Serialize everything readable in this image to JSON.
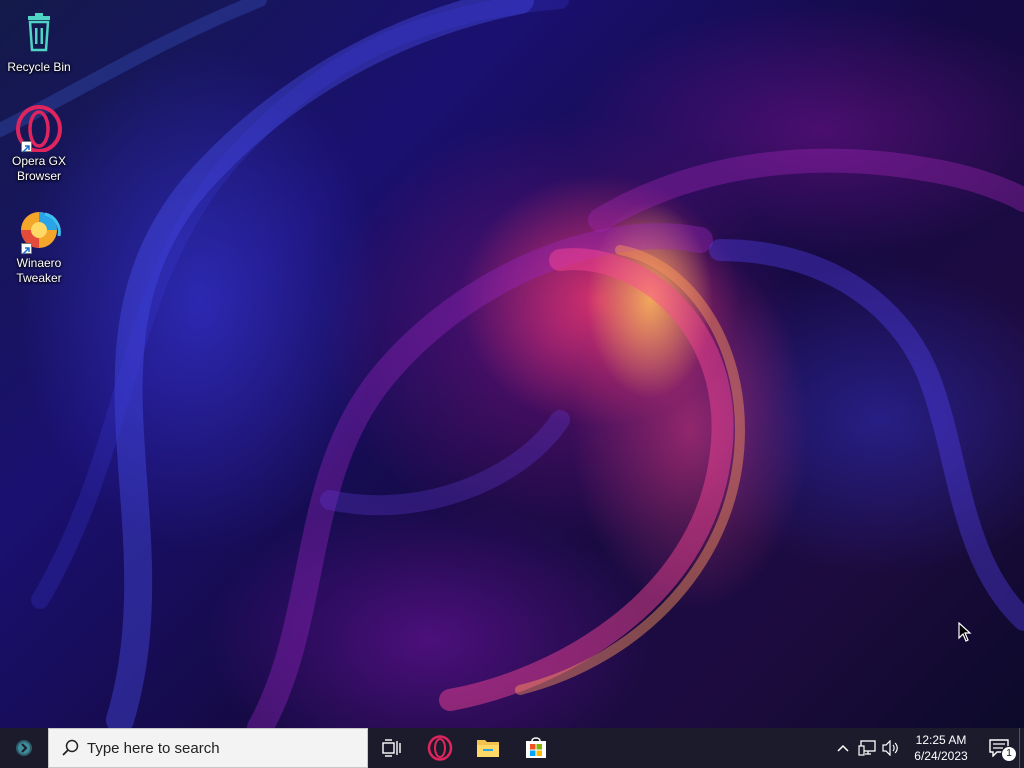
{
  "desktop": {
    "icons": [
      {
        "label": "Recycle Bin",
        "icon": "recycle-bin-icon"
      },
      {
        "label": "Opera GX Browser",
        "icon": "opera-gx-icon",
        "shortcut": true
      },
      {
        "label": "Winaero Tweaker",
        "icon": "winaero-tweaker-icon",
        "shortcut": true
      }
    ]
  },
  "taskbar": {
    "search_placeholder": "Type here to search",
    "apps": [
      {
        "name": "Task View",
        "icon": "task-view-icon"
      },
      {
        "name": "Opera GX",
        "icon": "opera-gx-icon"
      },
      {
        "name": "File Explorer",
        "icon": "file-explorer-icon"
      },
      {
        "name": "Microsoft Store",
        "icon": "store-icon"
      }
    ],
    "tray": {
      "icons": [
        "chevron-up-icon",
        "network-icon",
        "volume-icon"
      ],
      "time": "12:25 AM",
      "date": "6/24/2023",
      "notification_count": "1"
    }
  },
  "colors": {
    "taskbar_bg": "#1c1b2c",
    "search_bg": "#f3f3f3",
    "accent_opera": "#e0245e"
  }
}
